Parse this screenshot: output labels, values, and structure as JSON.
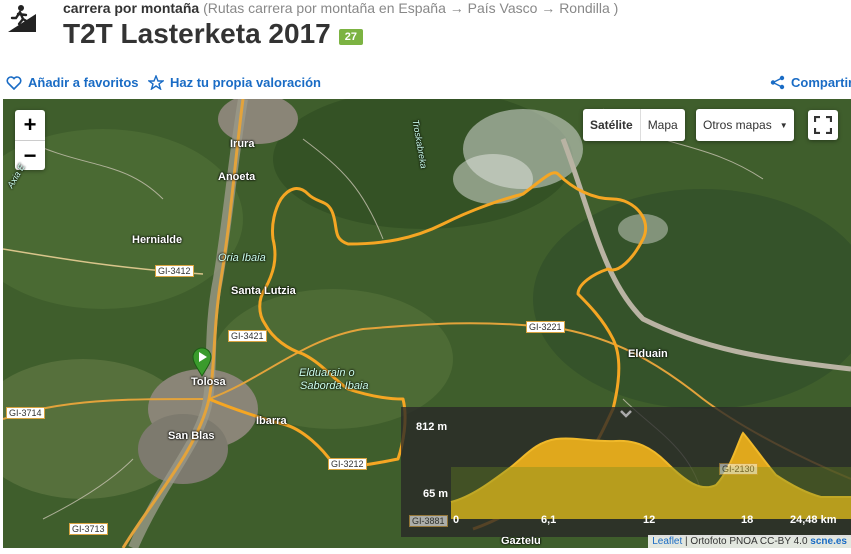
{
  "header": {
    "activity_type": "carrera por montaña",
    "breadcrumb": "(Rutas carrera por montaña en España → País Vasco → Rondilla )",
    "title": "T2T Lasterketa 2017",
    "badge": "27"
  },
  "actions": {
    "favorite": "Añadir a favoritos",
    "rate": "Haz tu propia valoración",
    "share": "Compartir"
  },
  "map": {
    "zoom_in": "+",
    "zoom_out": "−",
    "layer_satellite": "Satélite",
    "layer_map": "Mapa",
    "other_maps": "Otros mapas",
    "places": {
      "irura": "Irura",
      "anoeta": "Anoeta",
      "hernialde": "Hernialde",
      "oria": "Oria Ibaia",
      "santa_lutzia": "Santa Lutzia",
      "tolosa": "Tolosa",
      "elduarain": "Elduarain o",
      "saborda": "Saborda Ibaia",
      "ibarra": "Ibarra",
      "san_blas": "San Blas",
      "elduain": "Elduain",
      "gaztelu": "Gaztelu",
      "troskabreka": "Troskabreka",
      "axia": "Axia E"
    },
    "roads": {
      "gi3412": "GI-3412",
      "gi3421": "GI-3421",
      "gi3221": "GI-3221",
      "gi3714": "GI-3714",
      "gi3212": "GI-3212",
      "gi3713": "GI-3713",
      "gi2130": "GI-2130",
      "gi3881": "GI-3881"
    },
    "colors": {
      "route": "#f5a623",
      "road": "#e3a33b",
      "profile_fill": "#e0a81c"
    }
  },
  "profile": {
    "max_elevation": "812 m",
    "min_elevation": "65 m",
    "x_ticks": [
      "0",
      "6,1",
      "12",
      "18",
      "24,48 km"
    ]
  },
  "attribution": {
    "leaflet": "Leaflet",
    "text": " | Ortofoto PNOA CC-BY 4.0 ",
    "site": "scne.es"
  }
}
